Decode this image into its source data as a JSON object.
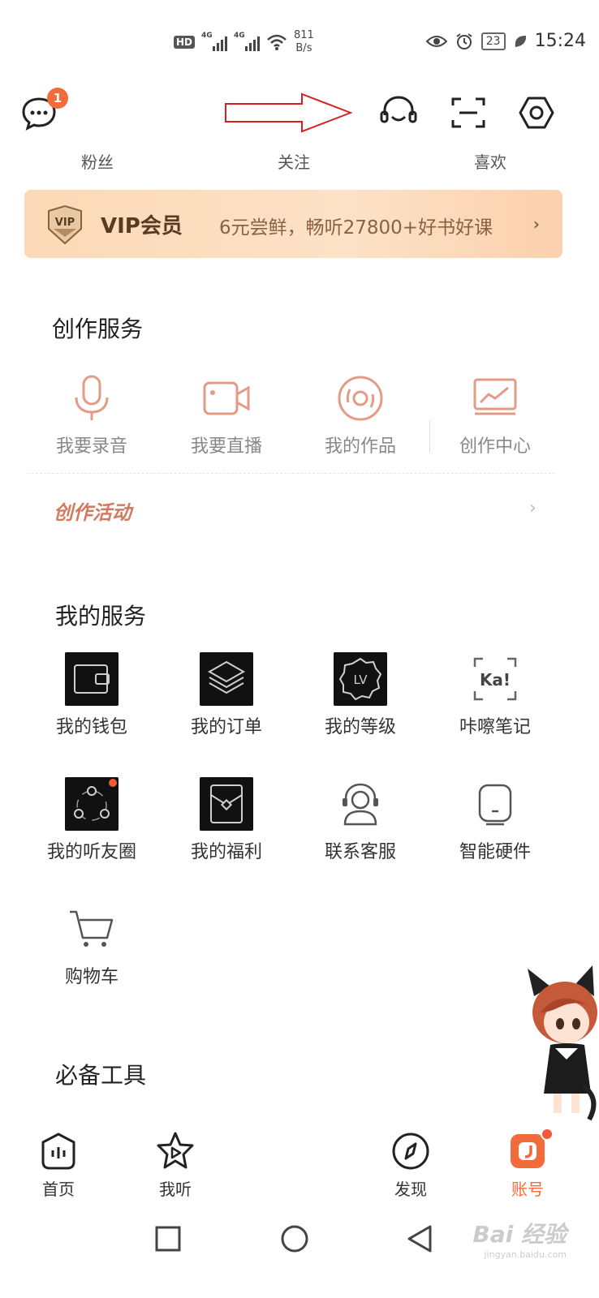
{
  "status_bar": {
    "hd": "HD",
    "net1": "4G",
    "net2": "4G",
    "speed_value": "811",
    "speed_unit": "B/s",
    "battery": "23",
    "time": "15:24"
  },
  "header": {
    "notification_count": "1",
    "stats": [
      "粉丝",
      "关注",
      "喜欢"
    ]
  },
  "vip": {
    "badge": "VIP",
    "title": "VIP会员",
    "desc": "6元尝鲜，畅听27800+好书好课",
    "chevron": "›"
  },
  "create_services": {
    "title": "创作服务",
    "items": [
      {
        "label": "我要录音",
        "icon": "microphone-icon"
      },
      {
        "label": "我要直播",
        "icon": "video-camera-icon"
      },
      {
        "label": "我的作品",
        "icon": "disc-icon"
      },
      {
        "label": "创作中心",
        "icon": "monitor-chart-icon"
      }
    ],
    "activity": "创作活动",
    "activity_chevron": "›"
  },
  "my_services": {
    "title": "我的服务",
    "items": [
      {
        "label": "我的钱包",
        "icon": "wallet-icon"
      },
      {
        "label": "我的订单",
        "icon": "layers-icon"
      },
      {
        "label": "我的等级",
        "icon": "level-badge-icon",
        "badge_text": "LV"
      },
      {
        "label": "咔嚓笔记",
        "icon": "ka-note-icon",
        "badge_text": "Ka!"
      },
      {
        "label": "我的听友圈",
        "icon": "friends-circle-icon"
      },
      {
        "label": "我的福利",
        "icon": "gift-envelope-icon"
      },
      {
        "label": "联系客服",
        "icon": "customer-service-icon"
      },
      {
        "label": "智能硬件",
        "icon": "smart-speaker-icon"
      },
      {
        "label": "购物车",
        "icon": "cart-icon"
      }
    ]
  },
  "tools": {
    "title": "必备工具"
  },
  "tabbar": {
    "items": [
      {
        "label": "首页",
        "icon": "home-icon"
      },
      {
        "label": "我听",
        "icon": "star-play-icon"
      },
      {
        "label": "发现",
        "icon": "compass-icon"
      },
      {
        "label": "账号",
        "icon": "account-icon"
      }
    ]
  },
  "watermark": {
    "text": "Bai 经验",
    "sub": "jingyan.baidu.com"
  },
  "colors": {
    "accent": "#f26b3a",
    "create_icon": "#e39a86",
    "vip_text": "#5a3a22",
    "annotation_arrow": "#d62020"
  }
}
